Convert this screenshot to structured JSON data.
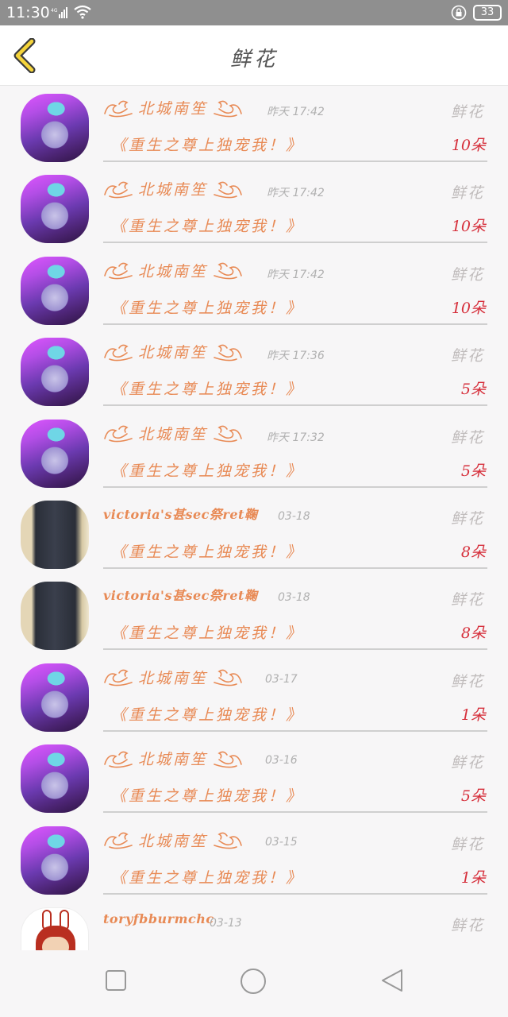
{
  "status_bar": {
    "time": "11:30",
    "battery": "33"
  },
  "header": {
    "title": "鲜花"
  },
  "items": [
    {
      "avatar": "a1",
      "name": "北城南笙",
      "decorated": true,
      "time": "昨天 17:42",
      "type": "鲜花",
      "book": "《重生之尊上独宠我！》",
      "count": "10朵"
    },
    {
      "avatar": "a1",
      "name": "北城南笙",
      "decorated": true,
      "time": "昨天 17:42",
      "type": "鲜花",
      "book": "《重生之尊上独宠我！》",
      "count": "10朵"
    },
    {
      "avatar": "a1",
      "name": "北城南笙",
      "decorated": true,
      "time": "昨天 17:42",
      "type": "鲜花",
      "book": "《重生之尊上独宠我！》",
      "count": "10朵"
    },
    {
      "avatar": "a1",
      "name": "北城南笙",
      "decorated": true,
      "time": "昨天 17:36",
      "type": "鲜花",
      "book": "《重生之尊上独宠我！》",
      "count": "5朵"
    },
    {
      "avatar": "a1",
      "name": "北城南笙",
      "decorated": true,
      "time": "昨天 17:32",
      "type": "鲜花",
      "book": "《重生之尊上独宠我！》",
      "count": "5朵"
    },
    {
      "avatar": "a2",
      "name": "victoria's甚sec祭ret鞠",
      "decorated": false,
      "time": "03-18",
      "type": "鲜花",
      "book": "《重生之尊上独宠我！》",
      "count": "8朵"
    },
    {
      "avatar": "a2",
      "name": "victoria's甚sec祭ret鞠",
      "decorated": false,
      "time": "03-18",
      "type": "鲜花",
      "book": "《重生之尊上独宠我！》",
      "count": "8朵"
    },
    {
      "avatar": "a1",
      "name": "北城南笙",
      "decorated": true,
      "time": "03-17",
      "type": "鲜花",
      "book": "《重生之尊上独宠我！》",
      "count": "1朵"
    },
    {
      "avatar": "a1",
      "name": "北城南笙",
      "decorated": true,
      "time": "03-16",
      "type": "鲜花",
      "book": "《重生之尊上独宠我！》",
      "count": "5朵"
    },
    {
      "avatar": "a1",
      "name": "北城南笙",
      "decorated": true,
      "time": "03-15",
      "type": "鲜花",
      "book": "《重生之尊上独宠我！》",
      "count": "1朵"
    },
    {
      "avatar": "a3",
      "name": "toryfbburmchc",
      "decorated": false,
      "time": "03-13",
      "type": "鲜花",
      "book": "",
      "count": ""
    }
  ],
  "nav_bar": {
    "icons": [
      "square-icon",
      "circle-icon",
      "triangle-back-icon"
    ]
  }
}
